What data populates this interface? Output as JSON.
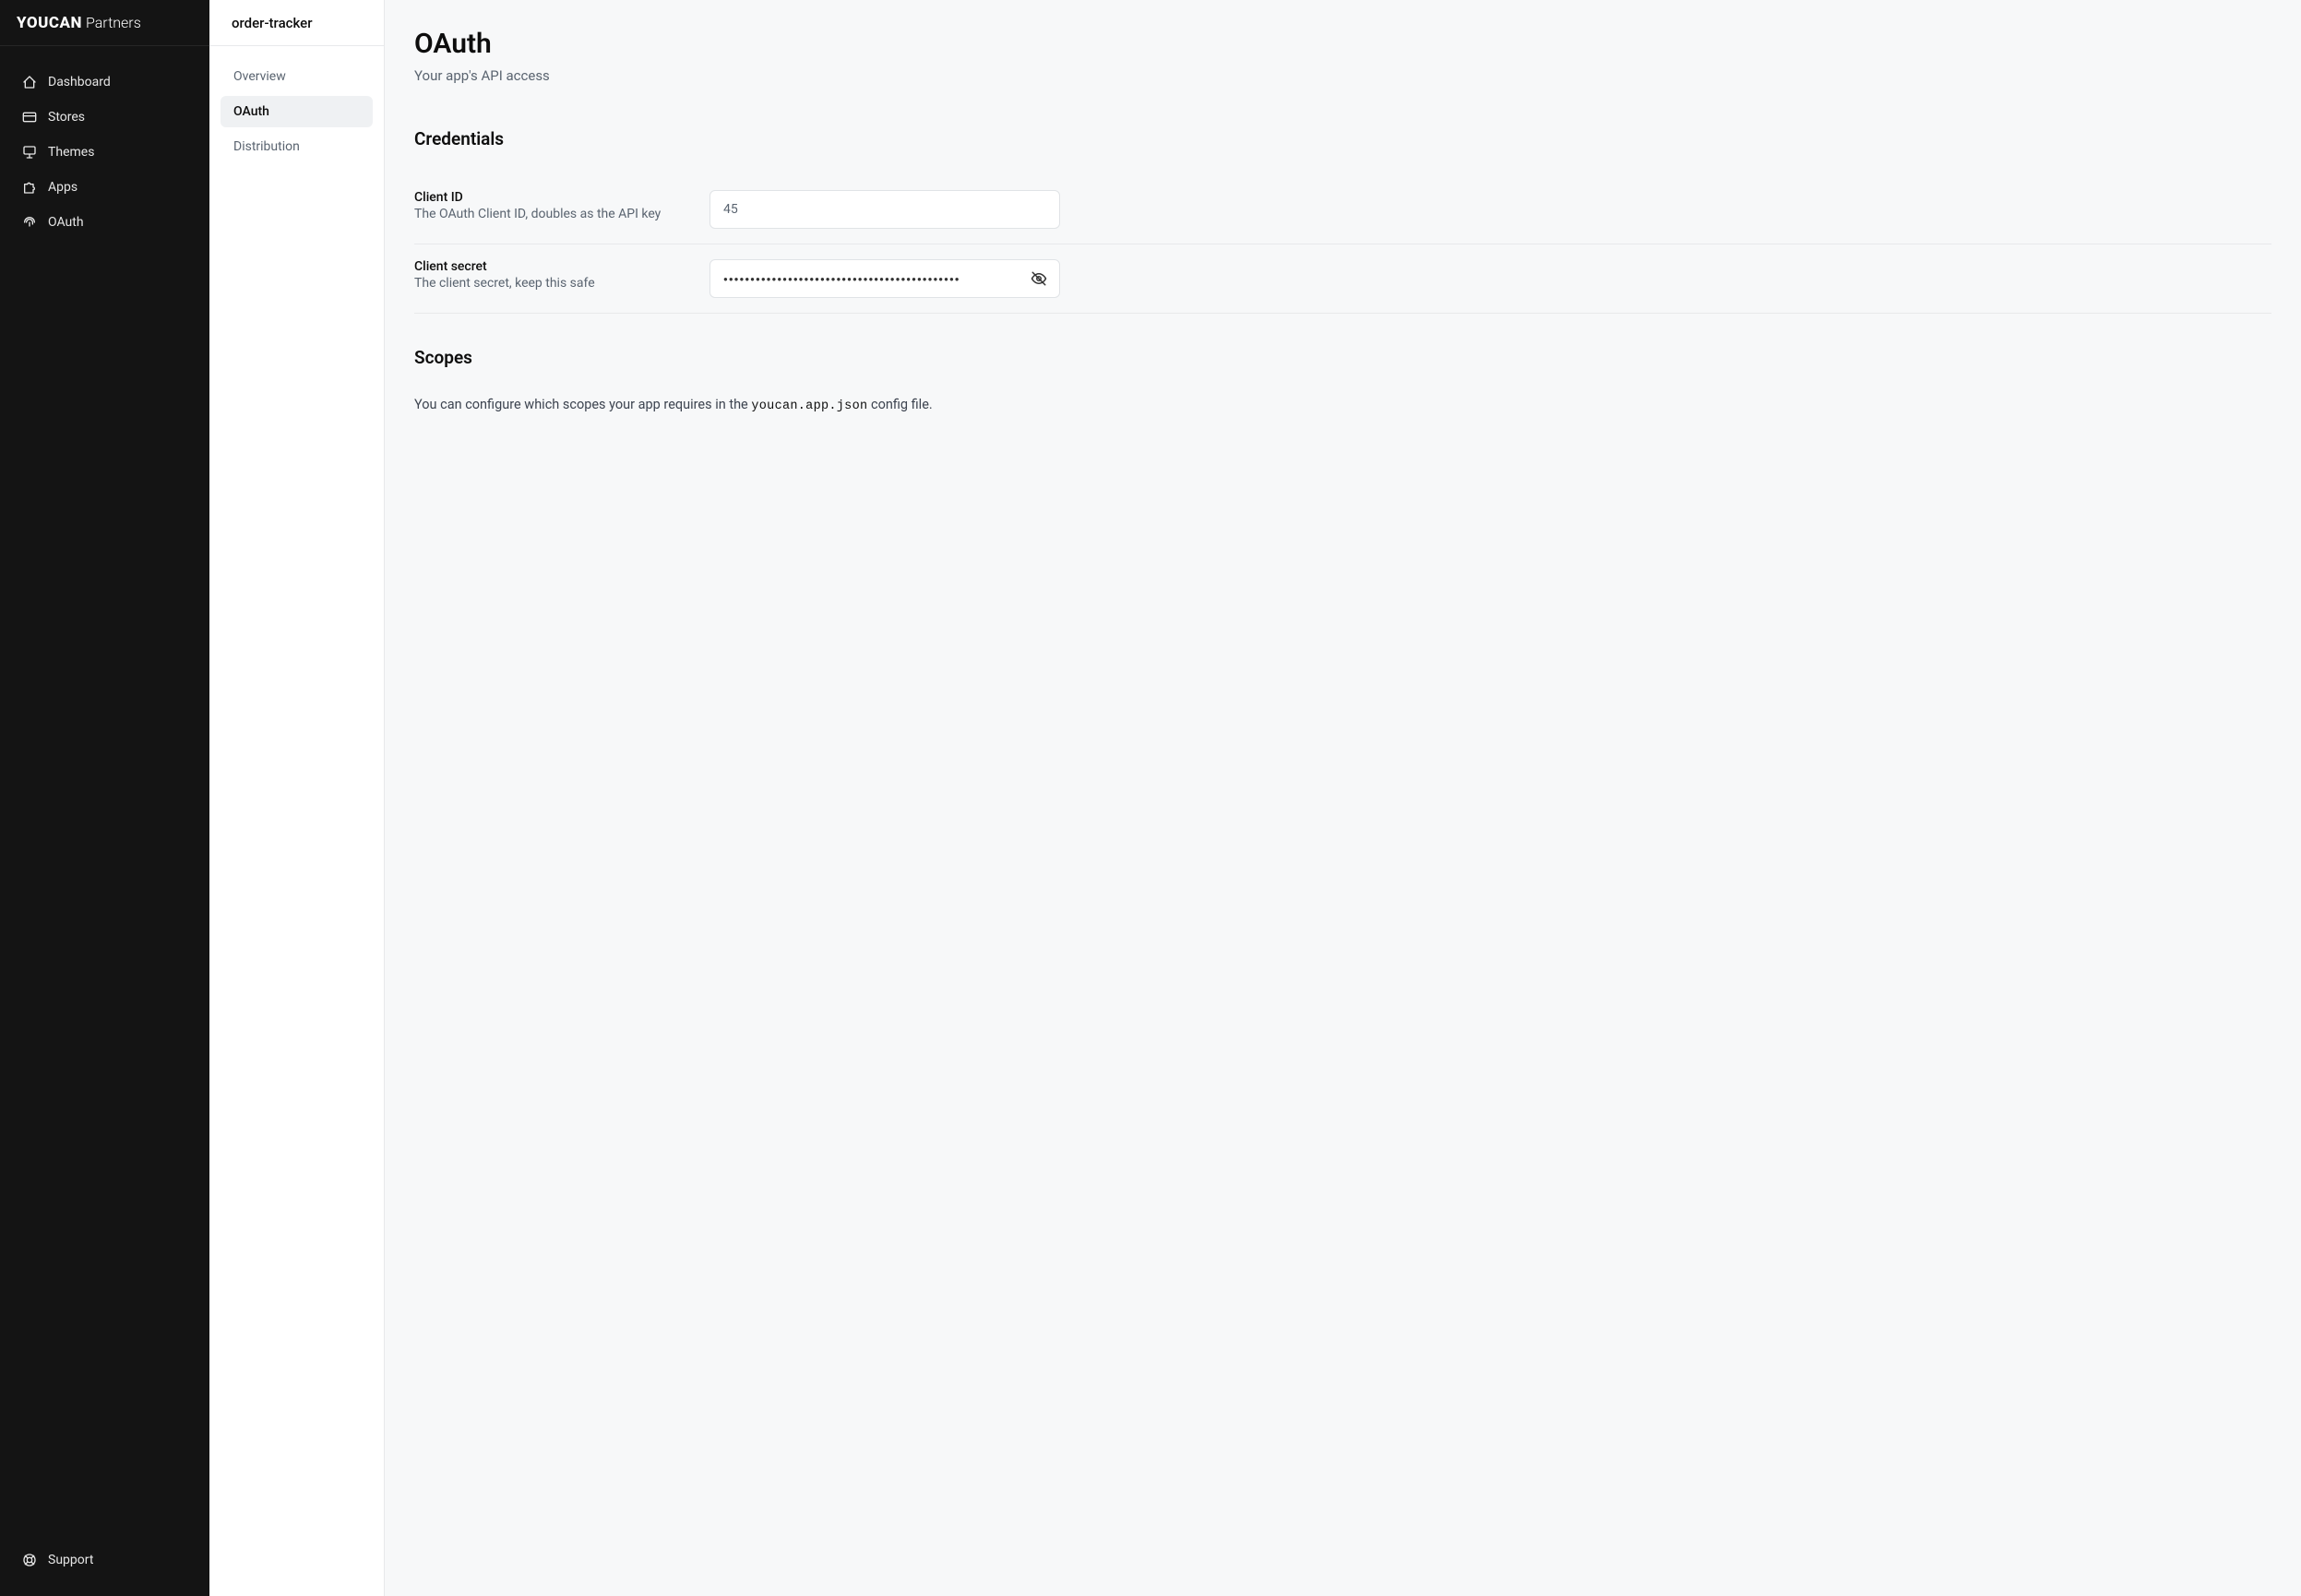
{
  "brand": {
    "main": "YOUCAN",
    "sub": "Partners"
  },
  "primaryNav": {
    "dashboard": "Dashboard",
    "stores": "Stores",
    "themes": "Themes",
    "apps": "Apps",
    "oauth": "OAuth",
    "support": "Support"
  },
  "secondarySidebar": {
    "title": "order-tracker",
    "items": {
      "overview": "Overview",
      "oauth": "OAuth",
      "distribution": "Distribution"
    }
  },
  "page": {
    "title": "OAuth",
    "subtitle": "Your app's API access"
  },
  "credentials": {
    "sectionTitle": "Credentials",
    "clientId": {
      "label": "Client ID",
      "desc": "The OAuth Client ID, doubles as the API key",
      "value": "45"
    },
    "clientSecret": {
      "label": "Client secret",
      "desc": "The client secret, keep this safe",
      "masked": "●●●●●●●●●●●●●●●●●●●●●●●●●●●●●●●●●●●●●●●●●●●●"
    }
  },
  "scopes": {
    "sectionTitle": "Scopes",
    "textBefore": "You can configure which scopes your app requires in the ",
    "configFile": "youcan.app.json",
    "textAfter": " config file."
  }
}
